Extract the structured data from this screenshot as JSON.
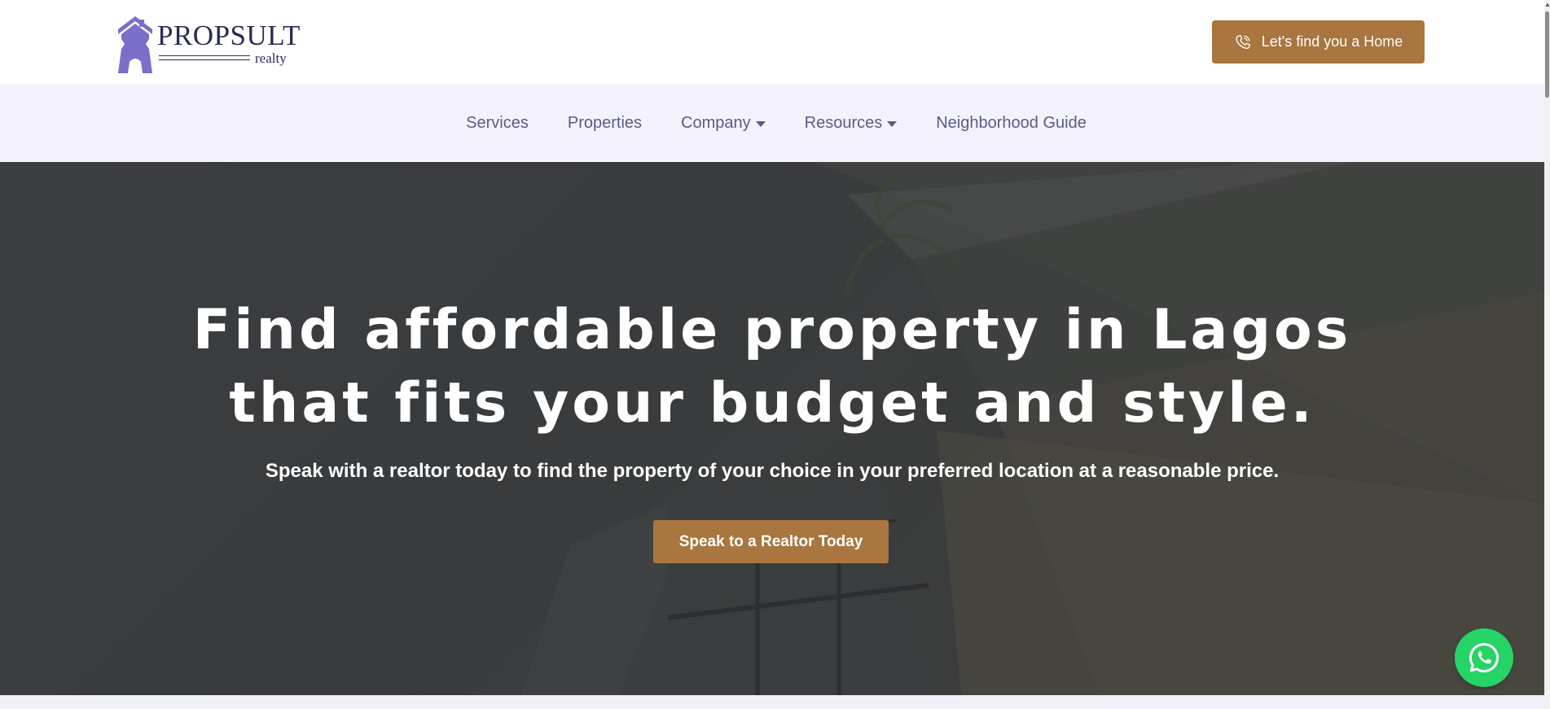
{
  "brand": {
    "name": "PROPSULT",
    "tagline": "realty",
    "logo_color": "#7c6fc9",
    "text_color": "#2b2b57"
  },
  "header": {
    "cta_label": "Let's find you a Home",
    "cta_icon": "phone-icon",
    "accent": "#a8763e"
  },
  "nav": {
    "items": [
      {
        "label": "Services",
        "has_dropdown": false
      },
      {
        "label": "Properties",
        "has_dropdown": false
      },
      {
        "label": "Company",
        "has_dropdown": true
      },
      {
        "label": "Resources",
        "has_dropdown": true
      },
      {
        "label": "Neighborhood Guide",
        "has_dropdown": false
      }
    ],
    "background": "#f4f3fd",
    "text_color": "#5a5a8a"
  },
  "hero": {
    "title": "Find affordable property in Lagos that fits your budget and style.",
    "subtitle": "Speak with a realtor today to find the property of your choice in your preferred location at a reasonable price.",
    "button_label": "Speak to a Realtor Today"
  },
  "floating": {
    "whatsapp_icon": "whatsapp-icon",
    "color": "#25d366"
  }
}
